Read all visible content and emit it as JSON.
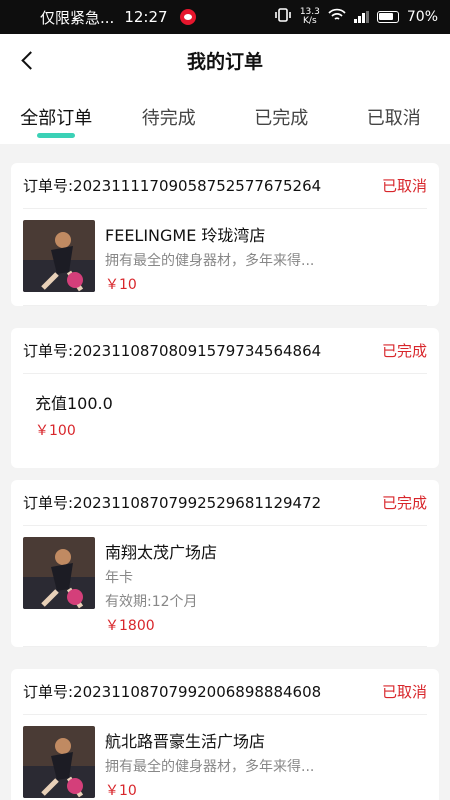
{
  "status_bar": {
    "carrier": "仅限紧急...",
    "time": "12:27",
    "net_speed_value": "13.3",
    "net_speed_unit": "K/s",
    "battery": "70%"
  },
  "header": {
    "title": "我的订单"
  },
  "tabs": [
    {
      "label": "全部订单",
      "active": true
    },
    {
      "label": "待完成",
      "active": false
    },
    {
      "label": "已完成",
      "active": false
    },
    {
      "label": "已取消",
      "active": false
    }
  ],
  "orders": [
    {
      "order_no": "订单号:2023111170905875257767526 4",
      "status": "已取消",
      "store": "FEELINGME 玲珑湾店",
      "desc": "拥有最全的健身器材，多年来得...",
      "price": "￥10"
    },
    {
      "order_no": "订单号:20231108708091579734564864",
      "status": "已完成",
      "store": "充值100.0",
      "price": "￥100"
    },
    {
      "order_no": "订单号:20231108707992529681129472",
      "status": "已完成",
      "store": "南翔太茂广场店",
      "card_type": "年卡",
      "validity": "有效期:12个月",
      "price": "￥1800"
    },
    {
      "order_no": "订单号:20231108707992006898884608",
      "status": "已取消",
      "store": "航北路晋豪生活广场店",
      "desc": "拥有最全的健身器材，多年来得...",
      "price": "￥10"
    }
  ],
  "colors": {
    "accent": "#3bd1b6",
    "status_red": "#d8262b"
  },
  "icons": [
    "back-arrow-icon",
    "weibo-icon",
    "vibrate-icon",
    "wifi-icon",
    "signal-icon",
    "battery-icon",
    "gym-thumbnail"
  ]
}
